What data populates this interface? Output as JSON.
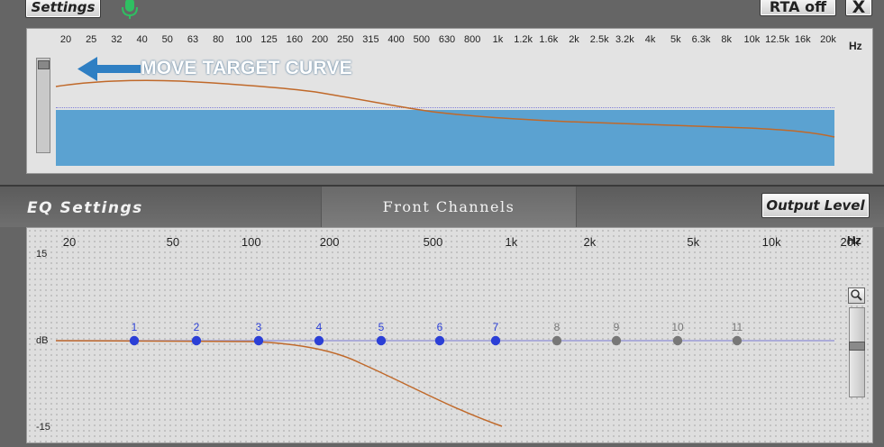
{
  "toolbar": {
    "settings_label": "Settings",
    "rta_label": "RTA off",
    "close_label": "X",
    "mic_icon": "microphone-icon"
  },
  "rta": {
    "freq_labels": [
      "20",
      "25",
      "32",
      "40",
      "50",
      "63",
      "80",
      "100",
      "125",
      "160",
      "200",
      "250",
      "315",
      "400",
      "500",
      "630",
      "800",
      "1k",
      "1.2k",
      "1.6k",
      "2k",
      "2.5k",
      "3.2k",
      "4k",
      "5k",
      "6.3k",
      "8k",
      "10k",
      "12.5k",
      "16k",
      "20k"
    ],
    "hz_unit": "Hz",
    "annotation": "MOVE TARGET CURVE",
    "fill_color": "#5ba2d1",
    "curve_color": "#c0692a"
  },
  "eq": {
    "title": "EQ Settings",
    "channel_tab": "Front Channels",
    "output_label": "Output Level",
    "freq_labels": [
      "20",
      "50",
      "100",
      "200",
      "500",
      "1k",
      "2k",
      "5k",
      "10k",
      "20k"
    ],
    "hz_unit": "Hz",
    "db_max": "15",
    "db_mid": "dB",
    "db_min": "-15",
    "bands": [
      {
        "num": "1",
        "active": true
      },
      {
        "num": "2",
        "active": true
      },
      {
        "num": "3",
        "active": true
      },
      {
        "num": "4",
        "active": true
      },
      {
        "num": "5",
        "active": true
      },
      {
        "num": "6",
        "active": true
      },
      {
        "num": "7",
        "active": true
      },
      {
        "num": "8",
        "active": false
      },
      {
        "num": "9",
        "active": false
      },
      {
        "num": "10",
        "active": false
      },
      {
        "num": "11",
        "active": false
      }
    ],
    "active_color": "#2b3fd6",
    "inactive_color": "#777777",
    "line_color": "#8f8fd6",
    "curve_color": "#c0692a"
  }
}
